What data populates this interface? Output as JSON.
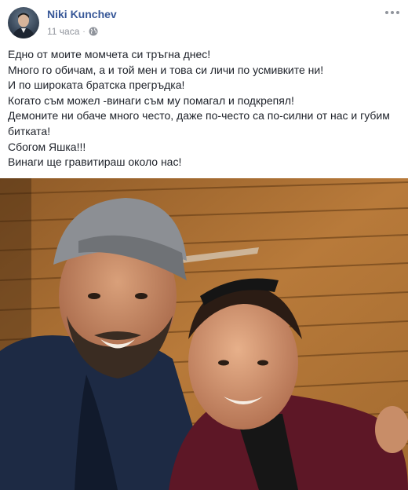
{
  "post": {
    "author": "Niki Kunchev",
    "timestamp": "11 часа",
    "separator": "·",
    "privacy_icon": "globe-icon",
    "more_icon": "more-options-icon",
    "lines": [
      "Едно от моите момчета си тръгна днес!",
      "Много го обичам, а и той мен и това си личи по усмивките ни!",
      "И по широката братска прегръдка!",
      "Когато съм можел -винаги съм му помагал и подкрепял!",
      "Демоните ни обаче много често, даже по-често са по-силни от нас и губим",
      "битката!",
      "Сбогом Яшка!!!",
      "Винаги ще гравитираш около нас!"
    ]
  },
  "colors": {
    "author_link": "#385898",
    "meta_text": "#90949c",
    "body_text": "#1d2129",
    "wood_wall": "#a36a30"
  }
}
